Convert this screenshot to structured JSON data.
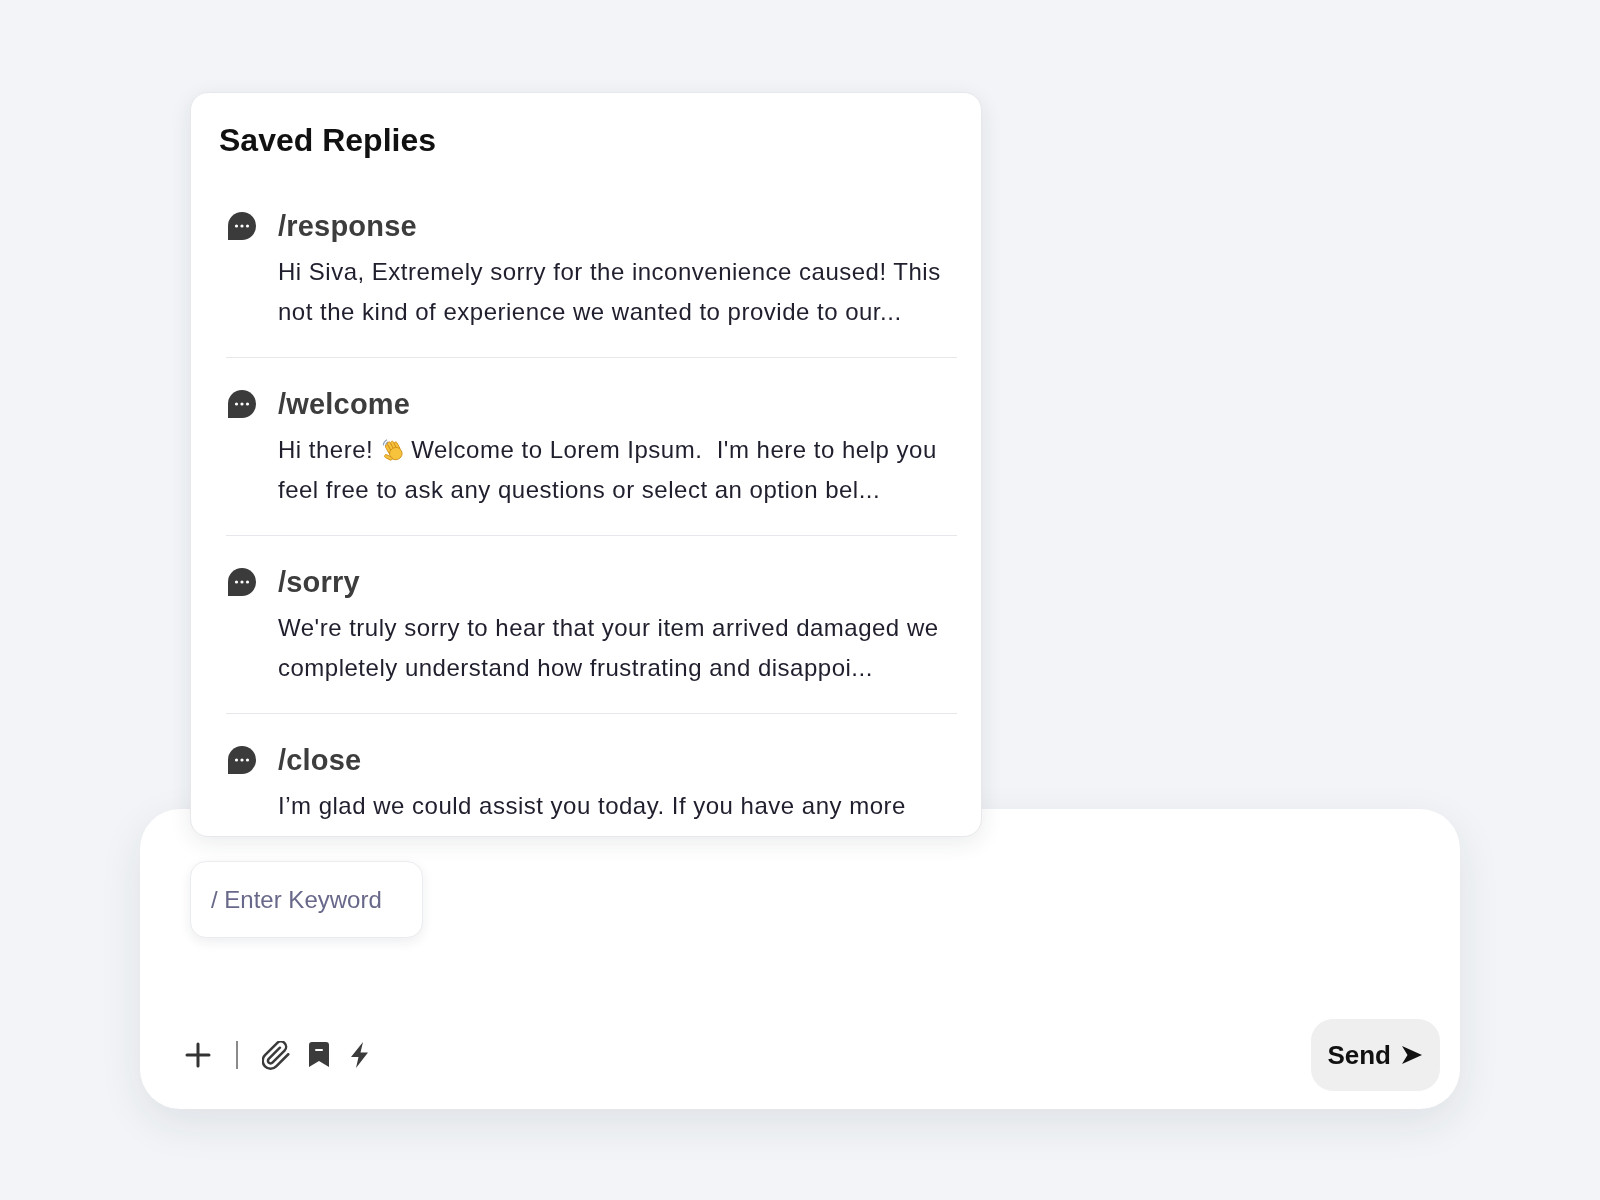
{
  "saved_replies": {
    "title": "Saved Replies",
    "items": [
      {
        "shortcut": "/response",
        "preview": [
          {
            "kind": "text",
            "text": "Hi Siva, Extremely sorry for the inconvenience caused! This not the kind of experience we wanted to provide to our..."
          }
        ]
      },
      {
        "shortcut": "/welcome",
        "preview": [
          {
            "kind": "text",
            "text": "Hi there!"
          },
          {
            "kind": "waving_hand"
          },
          {
            "kind": "text",
            "text": "Welcome to Lorem Ipsum.  I'm here to help you feel free to ask any questions or select an option bel..."
          }
        ]
      },
      {
        "shortcut": "/sorry",
        "preview": [
          {
            "kind": "text",
            "text": "We're truly sorry to hear that your item arrived damaged we completely understand how frustrating and disappoi..."
          }
        ]
      },
      {
        "shortcut": "/close",
        "preview": [
          {
            "kind": "text",
            "text": "I’m glad we could assist you today. If you have any more"
          }
        ]
      }
    ]
  },
  "composer": {
    "keyword_field": {
      "placeholder": "/ Enter Keyword"
    },
    "send_button": {
      "label": "Send"
    }
  }
}
